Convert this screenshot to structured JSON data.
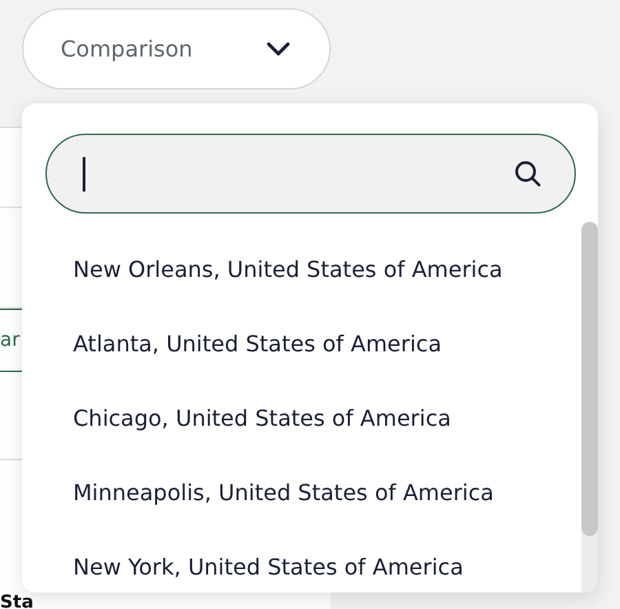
{
  "comparison_button": {
    "label": "Comparison"
  },
  "background": {
    "fragments": [
      {
        "text": "ar",
        "kind": "link"
      },
      {
        "text": "Sta",
        "kind": "bold"
      }
    ]
  },
  "dropdown": {
    "options": [
      {
        "label": "New Orleans, United States of America"
      },
      {
        "label": "Atlanta, United States of America"
      },
      {
        "label": "Chicago, United States of America"
      },
      {
        "label": "Minneapolis, United States of America"
      },
      {
        "label": "New York, United States of America"
      }
    ]
  }
}
